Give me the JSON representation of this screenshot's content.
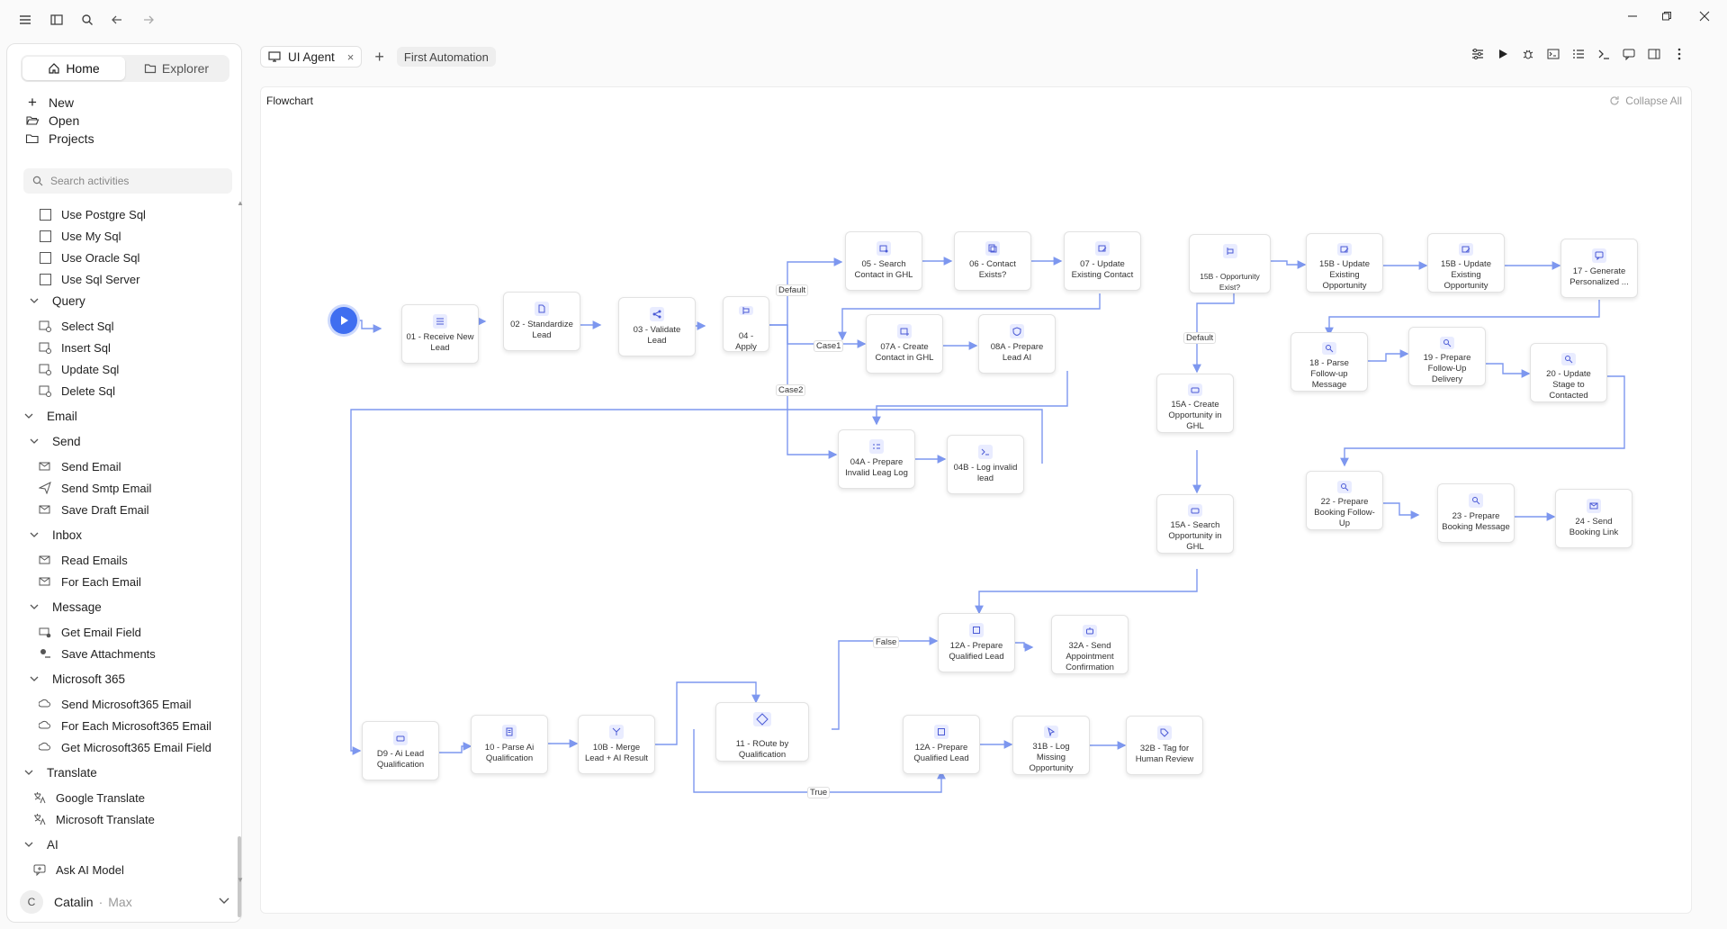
{
  "sidebar": {
    "tabs": [
      {
        "label": "Home"
      },
      {
        "label": "Explorer"
      }
    ],
    "quick": [
      {
        "label": "New"
      },
      {
        "label": "Open"
      },
      {
        "label": "Projects"
      }
    ],
    "search_placeholder": "Search activities",
    "tree": [
      {
        "label": "Use Postgre Sql"
      },
      {
        "label": "Use My Sql"
      },
      {
        "label": "Use Oracle Sql"
      },
      {
        "label": "Use Sql Server"
      },
      {
        "label": "Query"
      },
      {
        "label": "Select Sql"
      },
      {
        "label": "Insert Sql"
      },
      {
        "label": "Update Sql"
      },
      {
        "label": "Delete Sql"
      },
      {
        "label": "Email"
      },
      {
        "label": "Send"
      },
      {
        "label": "Send Email"
      },
      {
        "label": "Send Smtp Email"
      },
      {
        "label": "Save Draft Email"
      },
      {
        "label": "Inbox"
      },
      {
        "label": "Read Emails"
      },
      {
        "label": "For Each Email"
      },
      {
        "label": "Message"
      },
      {
        "label": "Get Email Field"
      },
      {
        "label": "Save Attachments"
      },
      {
        "label": "Microsoft 365"
      },
      {
        "label": "Send Microsoft365 Email"
      },
      {
        "label": "For Each Microsoft365 Email"
      },
      {
        "label": "Get Microsoft365 Email Field"
      },
      {
        "label": "Translate"
      },
      {
        "label": "Google Translate"
      },
      {
        "label": "Microsoft Translate"
      },
      {
        "label": "AI"
      },
      {
        "label": "Ask AI Model"
      }
    ],
    "user": {
      "initial": "C",
      "name": "Catalin",
      "separator": "·",
      "tier": "Max"
    }
  },
  "tabs": {
    "active_label": "UI Agent",
    "close_glyph": "×",
    "plus_glyph": "+",
    "secondary_label": "First Automation"
  },
  "canvas": {
    "title": "Flowchart",
    "collapse_label": "Collapse All"
  },
  "nodes": [
    {
      "label": "01 - Receive New Lead"
    },
    {
      "label": "02 - Standardize Lead"
    },
    {
      "label": "03 - Validate Lead"
    },
    {
      "label": "04 - Apply"
    },
    {
      "label": "05 - Search Contact in GHL"
    },
    {
      "label": "06 - Contact Exists?"
    },
    {
      "label": "07 - Update Existing Contact"
    },
    {
      "label": "07A - Create Contact in GHL"
    },
    {
      "label": "08A - Prepare Lead AI"
    },
    {
      "label": "04A - Prepare Invalid Leag Log"
    },
    {
      "label": "04B - Log invalid lead"
    },
    {
      "label": "15B - Opportunity Exist?"
    },
    {
      "label": "15B - Update Existing Opportunity"
    },
    {
      "label": "15B - Update Existing Opportunity"
    },
    {
      "label": "17 - Generate Personalized ..."
    },
    {
      "label": "18 - Parse Follow-up Message"
    },
    {
      "label": "19 - Prepare Follow-Up Delivery"
    },
    {
      "label": "20 - Update Stage to Contacted"
    },
    {
      "label": "15A - Create Opportunity in GHL"
    },
    {
      "label": "15A - Search Opportunity in GHL"
    },
    {
      "label": "22 - Prepare Booking Follow-Up"
    },
    {
      "label": "23 - Prepare Booking Message"
    },
    {
      "label": "24 - Send Booking Link"
    },
    {
      "label": "12A - Prepare Qualified Lead"
    },
    {
      "label": "32A - Send Appointment Confirmation"
    },
    {
      "label": "D9 - Ai Lead Qualification"
    },
    {
      "label": "10 - Parse Ai Qualification"
    },
    {
      "label": "10B - Merge Lead + AI Result"
    },
    {
      "label": "11 - ROute by Qualification"
    },
    {
      "label": "12A - Prepare Qualified Lead"
    },
    {
      "label": "31B - Log Missing Opportunity"
    },
    {
      "label": "32B - Tag for Human Review"
    }
  ],
  "edge_labels": {
    "default_top": "Default",
    "case1": "Case1",
    "case2": "Case2",
    "default_right": "Default",
    "false": "False",
    "true": "True"
  },
  "colors": {
    "accent": "#3f6ef0",
    "edge": "#7d97ef"
  }
}
